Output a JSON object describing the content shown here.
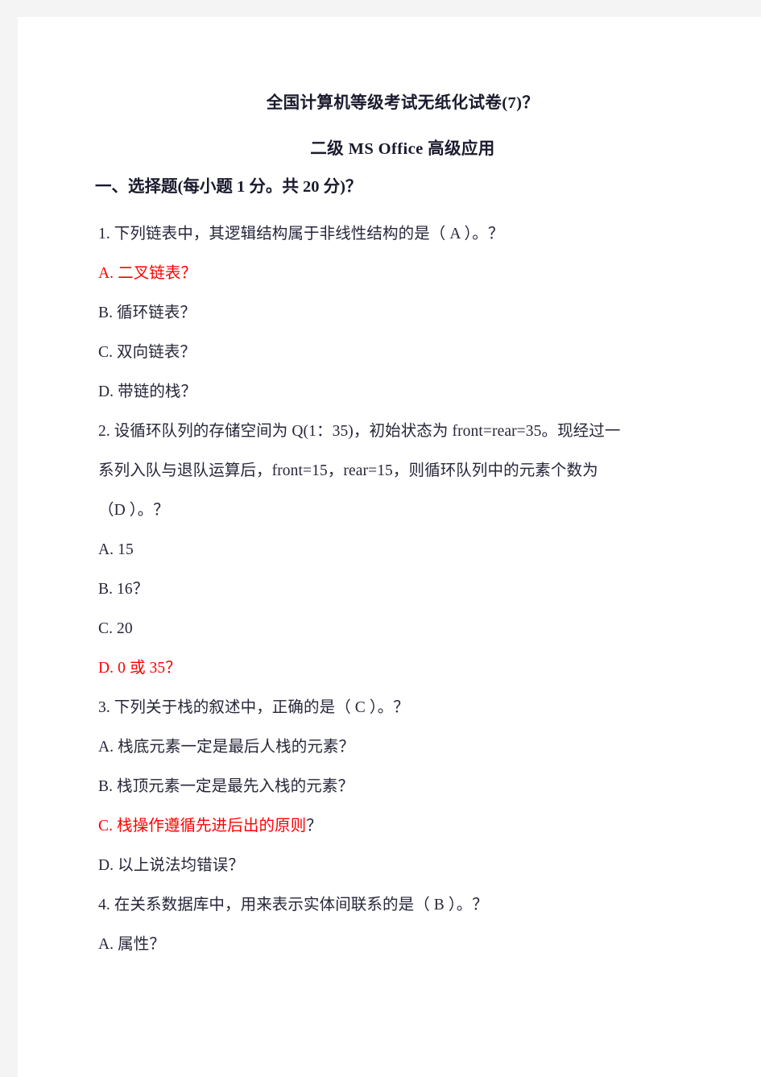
{
  "document": {
    "title": "全国计算机等级考试无纸化试卷(7)？",
    "subtitle": "二级 MS Office 高级应用",
    "section_heading": "一、选择题(每小题 1 分。共 20 分)？"
  },
  "colors": {
    "page_background": "#ffffff",
    "canvas_background": "#f4f4f4",
    "text": "#26263a",
    "answer_red": "#ff0000"
  },
  "content_lines": [
    {
      "id": "q1-stem",
      "text": "1. 下列链表中，其逻辑结构属于非线性结构的是（   A   ）。？",
      "color": "text"
    },
    {
      "id": "q1-opt-a",
      "text": "A. 二叉链表？",
      "color": "red"
    },
    {
      "id": "q1-opt-b",
      "text": "B. 循环链表？",
      "color": "text"
    },
    {
      "id": "q1-opt-c",
      "text": "C. 双向链表？",
      "color": "text"
    },
    {
      "id": "q1-opt-d",
      "text": "D. 带链的栈？",
      "color": "text"
    },
    {
      "id": "q2-stem-1",
      "text": "2. 设循环队列的存储空间为 Q(1：35)，初始状态为 front=rear=35。现经过一",
      "color": "text"
    },
    {
      "id": "q2-stem-2",
      "text": "系列入队与退队运算后，front=15，rear=15，则循环队列中的元素个数为",
      "color": "text"
    },
    {
      "id": "q2-stem-3",
      "text": "（D    ）。？",
      "color": "text"
    },
    {
      "id": "q2-opt-a",
      "text": "A. 15",
      "color": "text"
    },
    {
      "id": "q2-opt-b",
      "text": "B. 16？",
      "color": "text"
    },
    {
      "id": "q2-opt-c",
      "text": "C. 20",
      "color": "text"
    },
    {
      "id": "q2-opt-d",
      "text": "D. 0 或 35？",
      "color": "red"
    },
    {
      "id": "q3-stem",
      "text": "3. 下列关于栈的叙述中，正确的是（   C   ）。？",
      "color": "text"
    },
    {
      "id": "q3-opt-a",
      "text": "A. 栈底元素一定是最后人栈的元素？",
      "color": "text"
    },
    {
      "id": "q3-opt-b",
      "text": "B. 栈顶元素一定是最先入栈的元素？",
      "color": "text"
    },
    {
      "id": "q3-opt-c",
      "text": "C. 栈操作遵循先进后出的原则",
      "trailing": "？",
      "color": "red"
    },
    {
      "id": "q3-opt-d",
      "text": "D. 以上说法均错误？",
      "color": "text"
    },
    {
      "id": "q4-stem",
      "text": "4. 在关系数据库中，用来表示实体间联系的是（   B   ）。？",
      "color": "text"
    },
    {
      "id": "q4-opt-a",
      "text": "A. 属性？",
      "color": "text"
    }
  ]
}
